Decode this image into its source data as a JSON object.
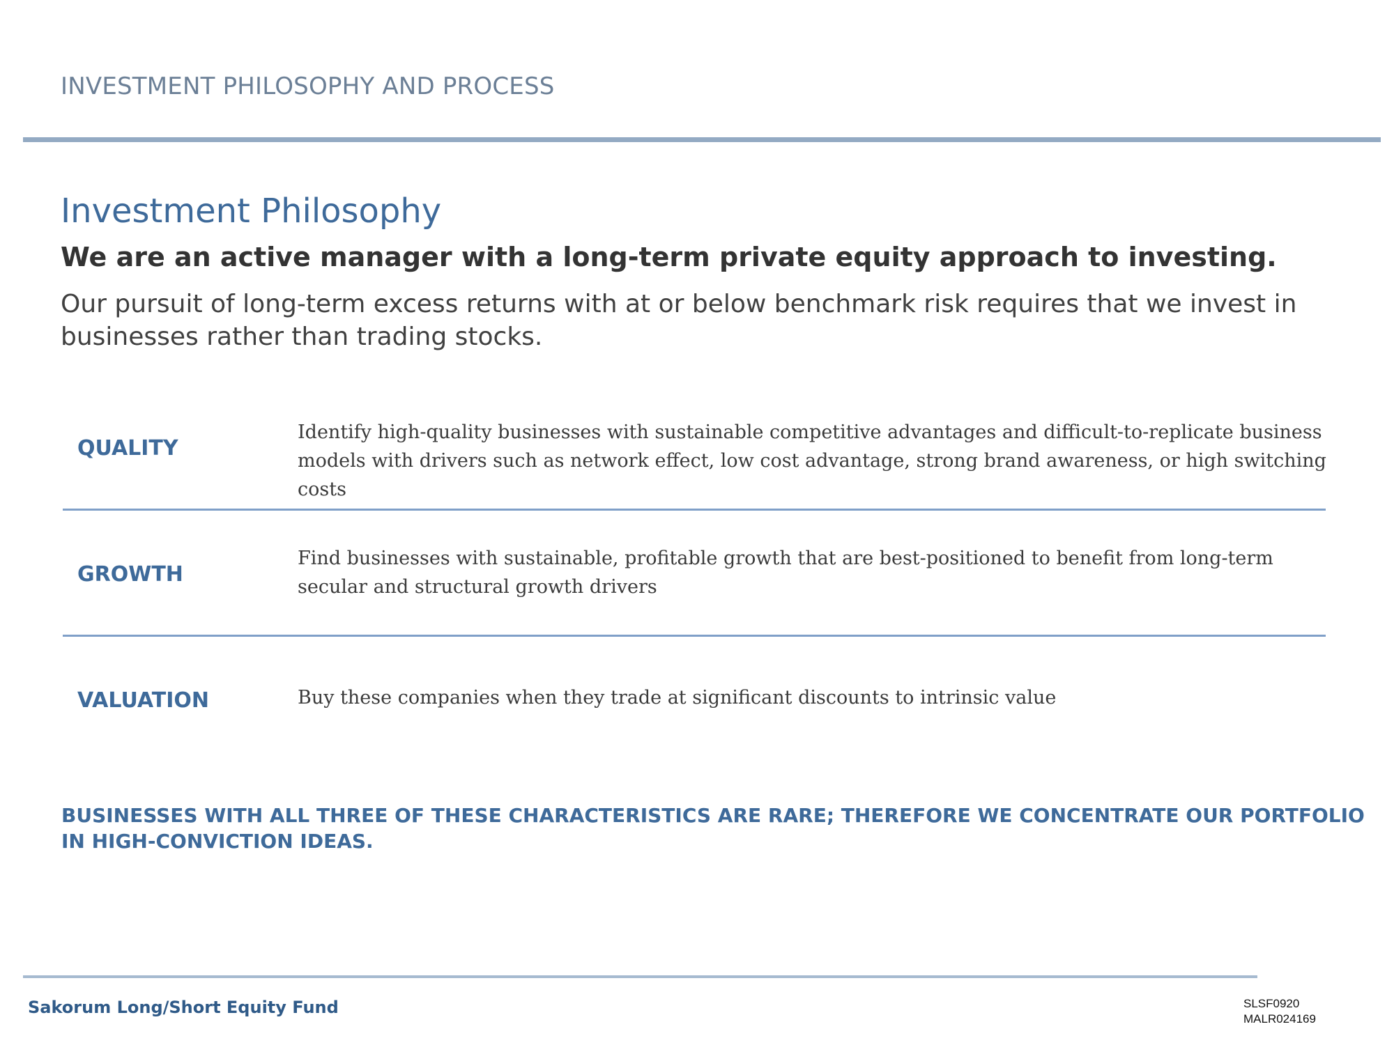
{
  "header": {
    "section_title": "INVESTMENT PHILOSOPHY AND PROCESS"
  },
  "philosophy": {
    "title": "Investment Philosophy",
    "tagline": "We are an active manager with a long-term private equity approach to investing.",
    "intro": "Our pursuit of long-term excess returns with at or below benchmark risk requires that we invest in businesses rather than trading stocks."
  },
  "pillars": [
    {
      "label": "QUALITY",
      "description": "Identify high-quality businesses with sustainable competitive advantages and difficult-to-replicate business models with drivers such as network effect, low cost advantage, strong brand awareness, or high switching costs"
    },
    {
      "label": "GROWTH",
      "description": "Find businesses with sustainable, profitable growth that are best-positioned to benefit from long-term secular and structural growth drivers"
    },
    {
      "label": "VALUATION",
      "description": "Buy these companies when they trade at significant discounts to intrinsic value"
    }
  ],
  "conclusion": "BUSINESSES WITH ALL THREE OF THESE CHARACTERISTICS ARE RARE; THEREFORE WE CONCENTRATE OUR PORTFOLIO IN HIGH-CONVICTION IDEAS.",
  "footer": {
    "fund_name": "Sakorum Long/Short Equity Fund",
    "code_1": "SLSF0920",
    "code_2": "MALR024169"
  },
  "colors": {
    "accent": "#3e6a9a",
    "header_text": "#6b7f96",
    "rule": "#93aac3"
  }
}
